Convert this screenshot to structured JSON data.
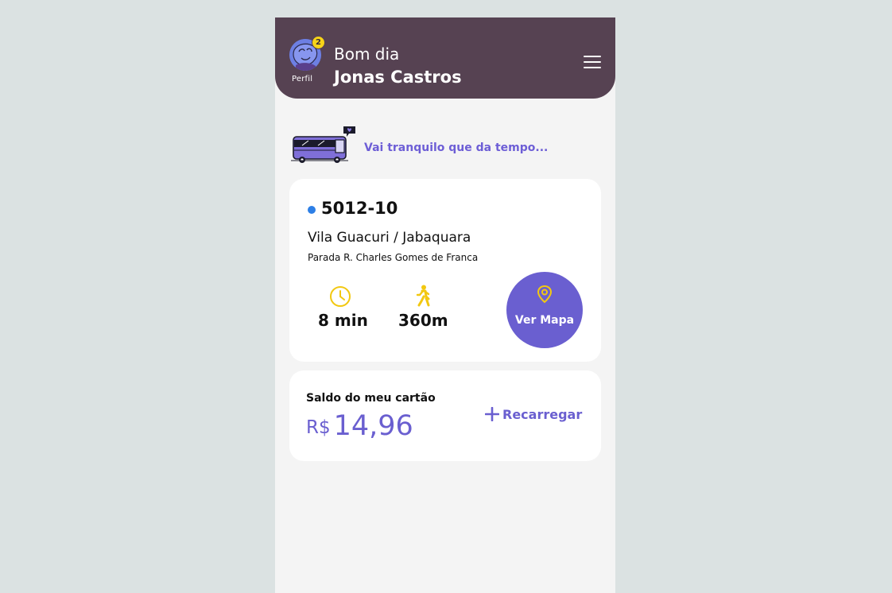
{
  "header": {
    "profile_label": "Perfil",
    "notification_count": "2",
    "greeting": "Bom dia",
    "user_name": "Jonas Castros",
    "menu_icon": "hamburger-menu-icon"
  },
  "tip": {
    "text": "Vai tranquilo que da tempo...",
    "illustration": "bus-illustration"
  },
  "bus_card": {
    "line_number": "5012-10",
    "line_status_color": "#2d7fe6",
    "route": "Vila Guacuri / Jabaquara",
    "stop": "Parada R. Charles Gomes de Franca",
    "arrival_time": "8 min",
    "walk_distance": "360m",
    "map_button_label": "Ver Mapa"
  },
  "balance_card": {
    "label": "Saldo do meu cartão",
    "currency": "R$",
    "value": "14,96",
    "recharge_label": "Recarregar"
  },
  "colors": {
    "header_bg": "#564252",
    "accent": "#6a5fd0",
    "icon_yellow": "#f2c811",
    "page_bg": "#f4f4f4"
  }
}
